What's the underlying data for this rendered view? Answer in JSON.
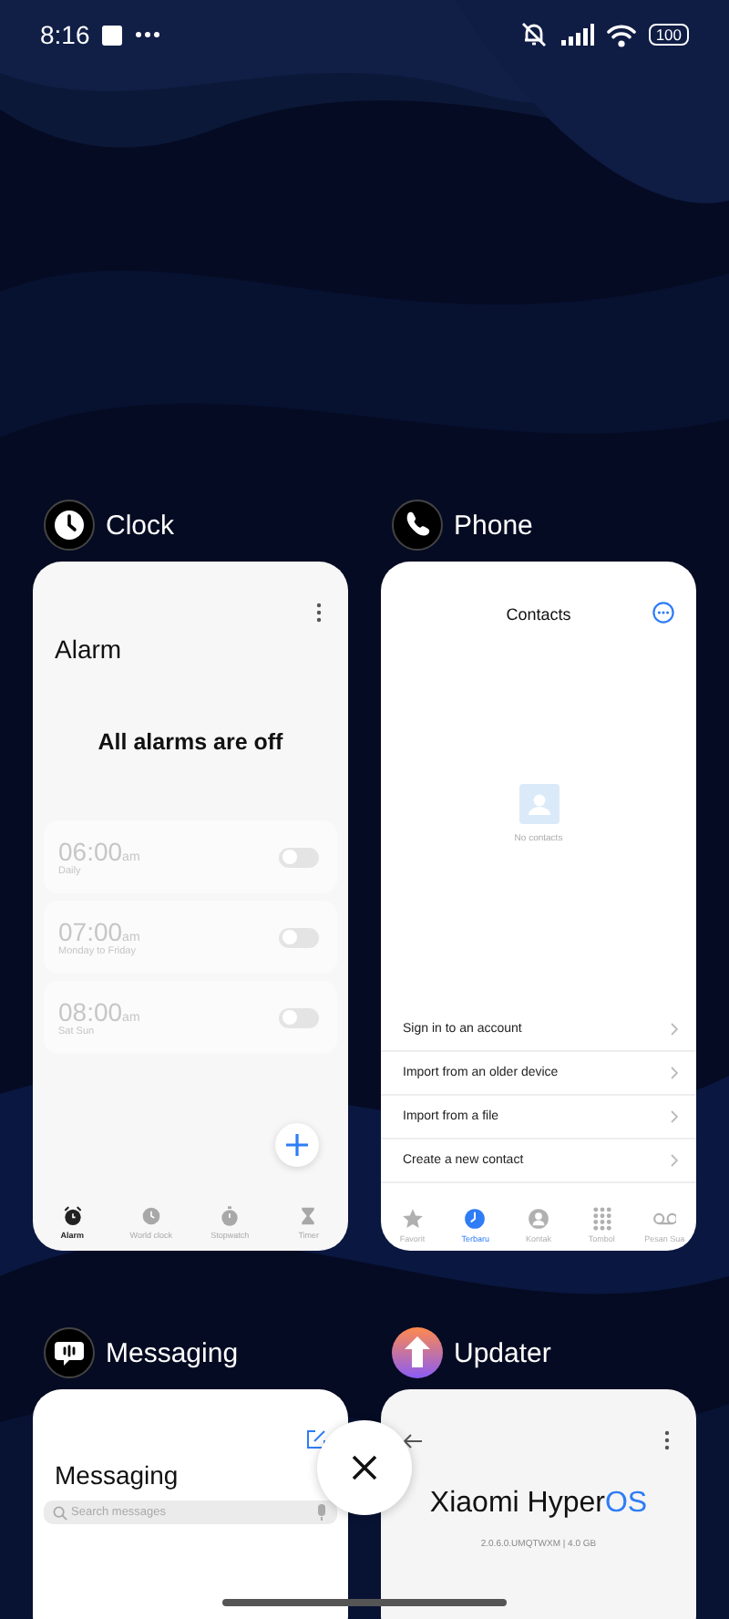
{
  "status_bar": {
    "time": "8:16",
    "battery": "100"
  },
  "apps": [
    {
      "kind": "clock",
      "name": "Clock",
      "screen": {
        "title": "Alarm",
        "message": "All alarms are off",
        "alarms": [
          {
            "time": "06:00",
            "period": "am",
            "repeat": "Daily",
            "on": false
          },
          {
            "time": "07:00",
            "period": "am",
            "repeat": "Monday to Friday",
            "on": false
          },
          {
            "time": "08:00",
            "period": "am",
            "repeat": "Sat Sun",
            "on": false
          }
        ],
        "tabs": [
          {
            "kind": "alarm",
            "label": "Alarm",
            "selected": true
          },
          {
            "kind": "world",
            "label": "World clock",
            "selected": false
          },
          {
            "kind": "stopwatch",
            "label": "Stopwatch",
            "selected": false
          },
          {
            "kind": "timer",
            "label": "Timer",
            "selected": false
          }
        ]
      }
    },
    {
      "kind": "phone",
      "name": "Phone",
      "screen": {
        "title": "Contacts",
        "empty": "No contacts",
        "actions": [
          "Sign in to an account",
          "Import from an older device",
          "Import from a file",
          "Create a new contact"
        ],
        "tabs": [
          {
            "kind": "star",
            "label": "Favorit",
            "selected": false
          },
          {
            "kind": "recent",
            "label": "Terbaru",
            "selected": true
          },
          {
            "kind": "person",
            "label": "Kontak",
            "selected": false
          },
          {
            "kind": "dialpad",
            "label": "Tombol",
            "selected": false
          },
          {
            "kind": "voicemail",
            "label": "Pesan Sua",
            "selected": false
          }
        ]
      }
    },
    {
      "kind": "messaging",
      "name": "Messaging",
      "screen": {
        "title": "Messaging",
        "search": {
          "placeholder": "Search messages"
        }
      }
    },
    {
      "kind": "updater",
      "name": "Updater",
      "screen": {
        "brand": "Xiaomi Hyper",
        "brand_accent": "OS",
        "version": "2.0.6.0.UMQTWXM | 4.0 GB"
      }
    }
  ]
}
